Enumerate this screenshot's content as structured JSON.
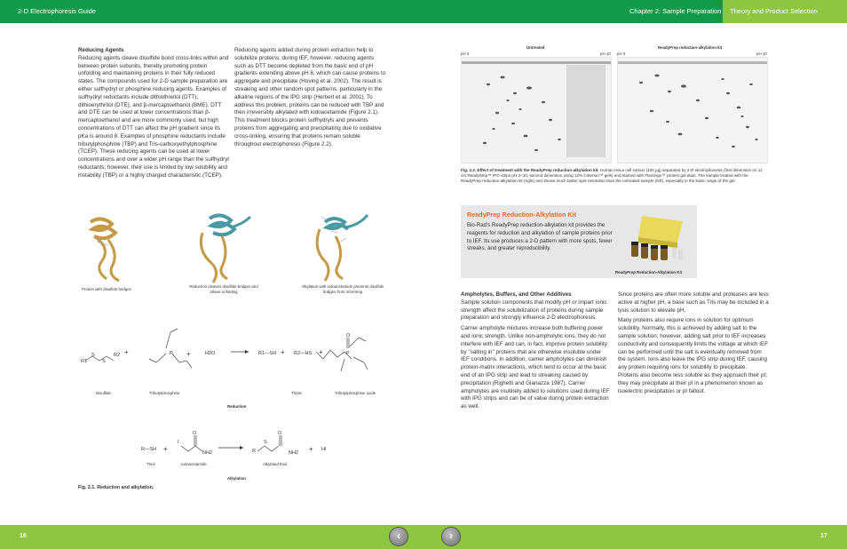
{
  "header": {
    "guide_title": "2-D Electrophoresis Guide",
    "chapter": "Chapter 2: Sample Preparation",
    "section_tab": "Theory and Product Selection"
  },
  "left_col1": {
    "heading": "Reducing Agents",
    "body": "Reducing agents cleave disulfide bond cross-links within and between protein subunits, thereby promoting protein unfolding and maintaining proteins in their fully reduced states. The compounds used for 2-D sample preparation are either sulfhydryl or phosphine reducing agents. Examples of sulfhydryl reductants include dithiothreitol (DTT), dithioerythritol (DTE), and β-mercaptoethanol (BME). DTT and DTE can be used at lower concentrations than β-mercaptoethanol and are more commonly used, but high concentrations of DTT can affect the pH gradient since its pKa is around 8. Examples of phosphine reductants include tributylphosphine (TBP) and Tris-carboxyethylphosphine (TCEP). These reducing agents can be used at lower concentrations and over a wider pH range than the sulfhydryl reductants; however, their use is limited by low solubility and instability (TBP) or a highly charged characteristic (TCEP)."
  },
  "left_col2": {
    "body": "Reducing agents added during protein extraction help to solubilize proteins; during IEF, however, reducing agents such as DTT become depleted from the basic end of pH gradients extending above pH 8, which can cause proteins to aggregate and precipitate (Hoving et al. 2002). The result is streaking and other random spot patterns, particularly in the alkaline regions of the IPG strip (Herbert et al. 2001). To address this problem, proteins can be reduced with TBP and then irreversibly alkylated with iodoacetamide (Figure 2.1). This treatment blocks protein sulfhydryls and prevents proteins from aggregating and precipitating due to oxidative cross-linking, ensuring that proteins remain soluble throughout electrophoresis (Figure 2.2)."
  },
  "protein_figures": {
    "cap1": "Protein with disulfide bridges",
    "cap2": "Reduction cleaves disulfide bridges and allows unfolding",
    "cap3": "Alkylation with iodoacetamide prevents disulfide bridges from reforming"
  },
  "reduction_scheme": {
    "disulfide": "Disulfide",
    "tbp": "Tributylphosphine",
    "thiols": "Thiols",
    "tbp_oxide": "Tributylphosphine oxide",
    "label": "Reduction",
    "h2o": "H2O",
    "r1": "R1",
    "r2": "R2",
    "s": "S",
    "p": "P",
    "o": "O",
    "r1sh": "R1—SH",
    "r2hs": "R2—HS",
    "plus": "+"
  },
  "alkylation_scheme": {
    "thiol": "Thiol",
    "iodo": "Iodoacetamide",
    "alkylated": "Alkylated thiol",
    "label": "Alkylation",
    "rsh": "R—SH",
    "i": "I",
    "r": "R",
    "s": "S",
    "o": "O",
    "nh2": "NH2",
    "hi": "HI",
    "plus": "+"
  },
  "fig21_caption": "Fig. 2.1. Reduction and alkylation.",
  "gels": {
    "untreated_title": "Untreated",
    "treated_title": "ReadyPrep reduction-alkylation kit",
    "ph3": "pH 3",
    "ph10": "pH 10"
  },
  "fig22": {
    "title": "Fig. 2.2. Effect of treatment with the ReadyPrep reduction-alkylation kit.",
    "body": "Human HeLa cell extract (100 µg) separated by 2-D electrophoresis (first dimension on 11 cm ReadyStrip™ IPG strips pH 3–10, second dimension using 12% Criterion™ gels) and stained with Flamingo™ protein gel stain. The sample treated with the ReadyPrep reduction-alkylation kit (right) and shows much better spot resolution than the untreated sample (left), especially in the basic range of the gel."
  },
  "kit_box": {
    "title": "ReadyPrep Reduction-Alkylation Kit",
    "body": "Bio-Rad's ReadyPrep reduction-alkylation kit provides the reagents for reduction and alkylation of sample proteins prior to IEF. Its use produces a 2-D pattern with more spots, fewer streaks, and greater reproducibility.",
    "image_caption": "ReadyPrep Reduction-Alkylation Kit"
  },
  "right_col1": {
    "heading": "Ampholytes, Buffers, and Other Additives",
    "p1": "Sample solution components that modify pH or impart ionic strength affect the solubilization of proteins during sample preparation and strongly influence 2-D electrophoresis.",
    "p2": "Carrier ampholyte mixtures increase both buffering power and ionic strength. Unlike non-ampholytic ions, they do not interfere with IEF and can, in fact, improve protein solubility by \"salting in\" proteins that are otherwise insoluble under IEF conditions. In addition, carrier ampholytes can diminish protein-matrix interactions, which tend to occur at the basic end of an IPG strip and lead to streaking caused by precipitation (Righetti and Gianazza 1987). Carrier ampholytes are routinely added to solutions used during IEF with IPG strips and can be of value during protein extraction as well."
  },
  "right_col2": {
    "p1": "Since proteins are often more soluble and proteases are less active at higher pH, a base such as Tris may be included in a lysis solution to elevate pH.",
    "p2": "Many proteins also require ions in solution for optimum solubility. Normally, this is achieved by adding salt to the sample solution; however, adding salt prior to IEF increases conductivity and consequently limits the voltage at which IEF can be performed until the salt is eventually removed from the system. Ions also leave the IPG strip during IEF, causing any protein requiring ions for solubility to precipitate. Proteins also become less soluble as they approach their pI; they may precipitate at their pI in a phenomenon known as isoelectric precipitation or pI fallout."
  },
  "footer": {
    "page_left": "16",
    "page_right": "17",
    "prev_icon": "chevron-left-icon",
    "next_icon": "chevron-right-icon"
  },
  "colors": {
    "header_green": "#119a48",
    "footer_green": "#8dc63f",
    "kit_orange": "#ea6a1e",
    "helix_teal": "#4a9aa3"
  }
}
